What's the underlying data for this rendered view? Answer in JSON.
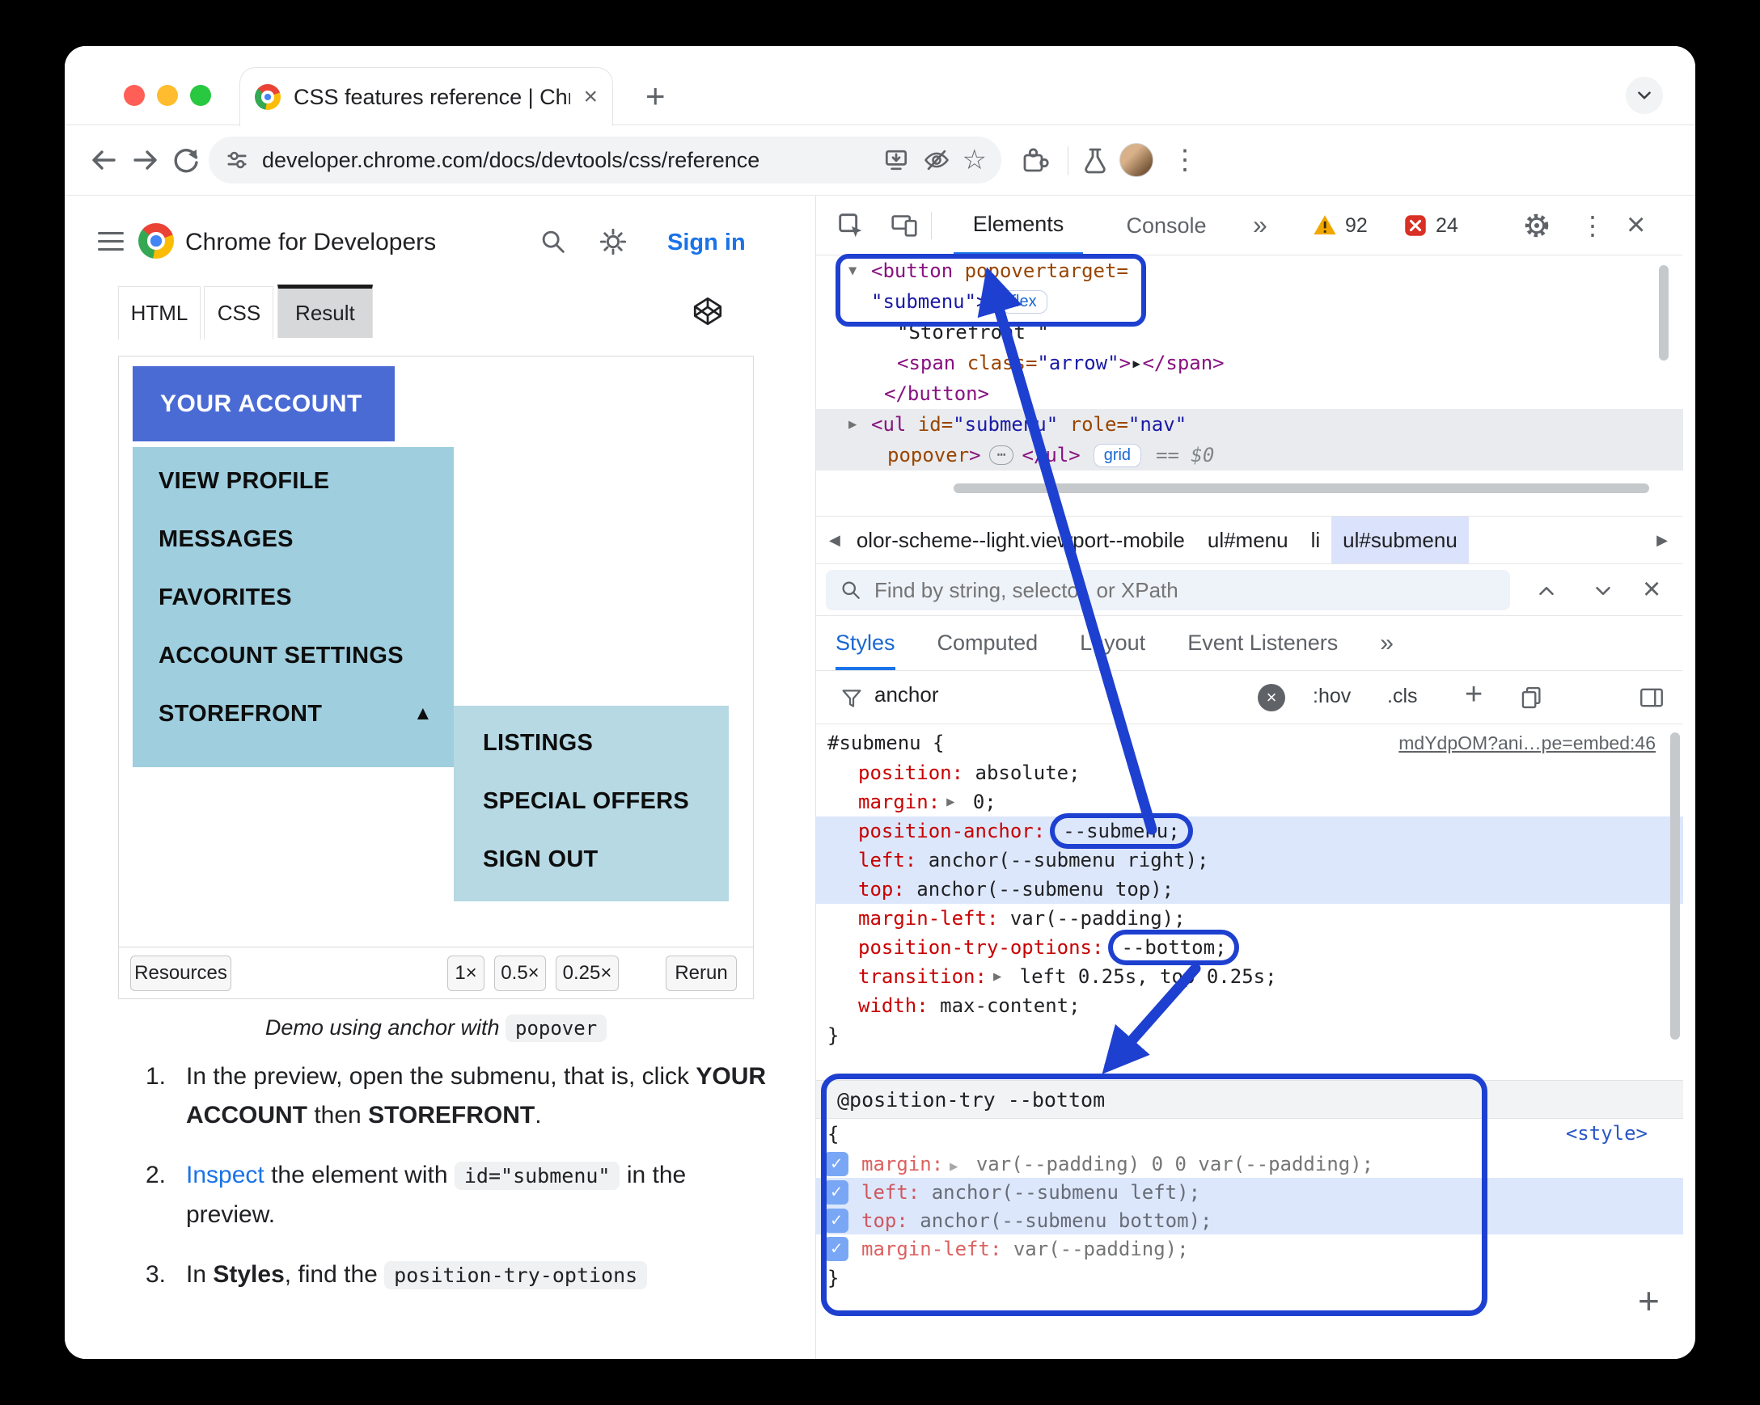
{
  "icons": {
    "plus": "+",
    "more_tabs": "»",
    "close": "×",
    "overflow_v": "⋮",
    "star": "☆",
    "chevron_left": "◀",
    "chevron_right": "▶",
    "tri_open": "▼",
    "tri_closed": "▶",
    "tri_up": "▲",
    "ellipsis": "⋯",
    "check": "✓"
  },
  "browser": {
    "tab_title": "CSS features reference  |  Chr",
    "url": "developer.chrome.com/docs/devtools/css/reference"
  },
  "docs": {
    "brand": "Chrome for Developers",
    "sign_in": "Sign in",
    "code_tabs": [
      "HTML",
      "CSS",
      "Result"
    ],
    "demo": {
      "account_button": "YOUR ACCOUNT",
      "menu_items": [
        "VIEW PROFILE",
        "MESSAGES",
        "FAVORITES",
        "ACCOUNT SETTINGS",
        "STOREFRONT"
      ],
      "submenu_items": [
        "LISTINGS",
        "SPECIAL OFFERS",
        "SIGN OUT"
      ],
      "resources_label": "Resources",
      "scales": [
        "1×",
        "0.5×",
        "0.25×"
      ],
      "rerun": "Rerun"
    },
    "caption": {
      "text": "Demo using anchor with ",
      "code": "popover"
    },
    "steps": {
      "n1": "1.",
      "s1a": "In the preview, open the submenu, that is, click ",
      "s1b": "YOUR ACCOUNT",
      "s1c": " then ",
      "s1d": "STOREFRONT",
      "s1e": ".",
      "n2": "2.",
      "s2a": "Inspect",
      "s2b": " the element with ",
      "s2c": "id=\"submenu\"",
      "s2d": " in the preview.",
      "n3": "3.",
      "s3a": "In ",
      "s3b": "Styles",
      "s3c": ", find the ",
      "s3d": "position-try-options"
    }
  },
  "devtools": {
    "tabs": {
      "elements": "Elements",
      "console": "Console",
      "warn_count": "92",
      "error_count": "24"
    },
    "dom": {
      "l1_tag": "<button",
      "l1_attr": " popovertarget=",
      "l2_val": "\"submenu\">",
      "l2_badge": "flex",
      "l3_text": "\"Storefront \"",
      "l4_tag1": "<span",
      "l4_attr": " class=",
      "l4_val": "\"arrow\"",
      "l4_gt": ">",
      "l4_txt": "▸",
      "l4_tag2": "</span>",
      "l5_tag": "</button>",
      "l6_tag": "<ul",
      "l6_attr1": " id=",
      "l6_val1": "\"submenu\"",
      "l6_attr2": " role=",
      "l6_val2": "\"nav\"",
      "l7_attr": "popover",
      "l7_gt": ">",
      "l7_tag": "</ul>",
      "l7_badge": "grid",
      "l7_eq": "== $0"
    },
    "breadcrumbs": [
      "olor-scheme--light.viewport--mobile",
      "ul#menu",
      "li",
      "ul#submenu"
    ],
    "search_placeholder": "Find by string, selector, or XPath",
    "panel_tabs": [
      "Styles",
      "Computed",
      "Layout",
      "Event Listeners"
    ],
    "filter": {
      "value": "anchor",
      "hov": ":hov",
      "cls": ".cls"
    },
    "rule": {
      "selector": "#submenu {",
      "link": "mdYdpOM?ani…pe=embed:46",
      "close": "}",
      "props": [
        {
          "name": "position:",
          "value": " absolute;"
        },
        {
          "name": "margin:",
          "value": " 0;"
        },
        {
          "name": "position-anchor:",
          "value": "--submenu;"
        },
        {
          "name": "left:",
          "value": " anchor(--submenu right);"
        },
        {
          "name": "top:",
          "value": " anchor(--submenu top);"
        },
        {
          "name": "margin-left:",
          "value": " var(--padding);"
        },
        {
          "name": "position-try-options:",
          "value": "--bottom;"
        },
        {
          "name": "transition:",
          "value": " left 0.25s, top 0.25s;"
        },
        {
          "name": "width:",
          "value": " max-content;"
        }
      ]
    },
    "tryblock": {
      "header": "@position-try --bottom",
      "style_link": "<style>",
      "open": "{",
      "close": "}",
      "props": [
        {
          "name": "margin:",
          "value": " var(--padding) 0 0 var(--padding);"
        },
        {
          "name": "left:",
          "value": " anchor(--submenu left);"
        },
        {
          "name": "top:",
          "value": " anchor(--submenu bottom);"
        },
        {
          "name": "margin-left:",
          "value": " var(--padding);"
        }
      ]
    }
  }
}
